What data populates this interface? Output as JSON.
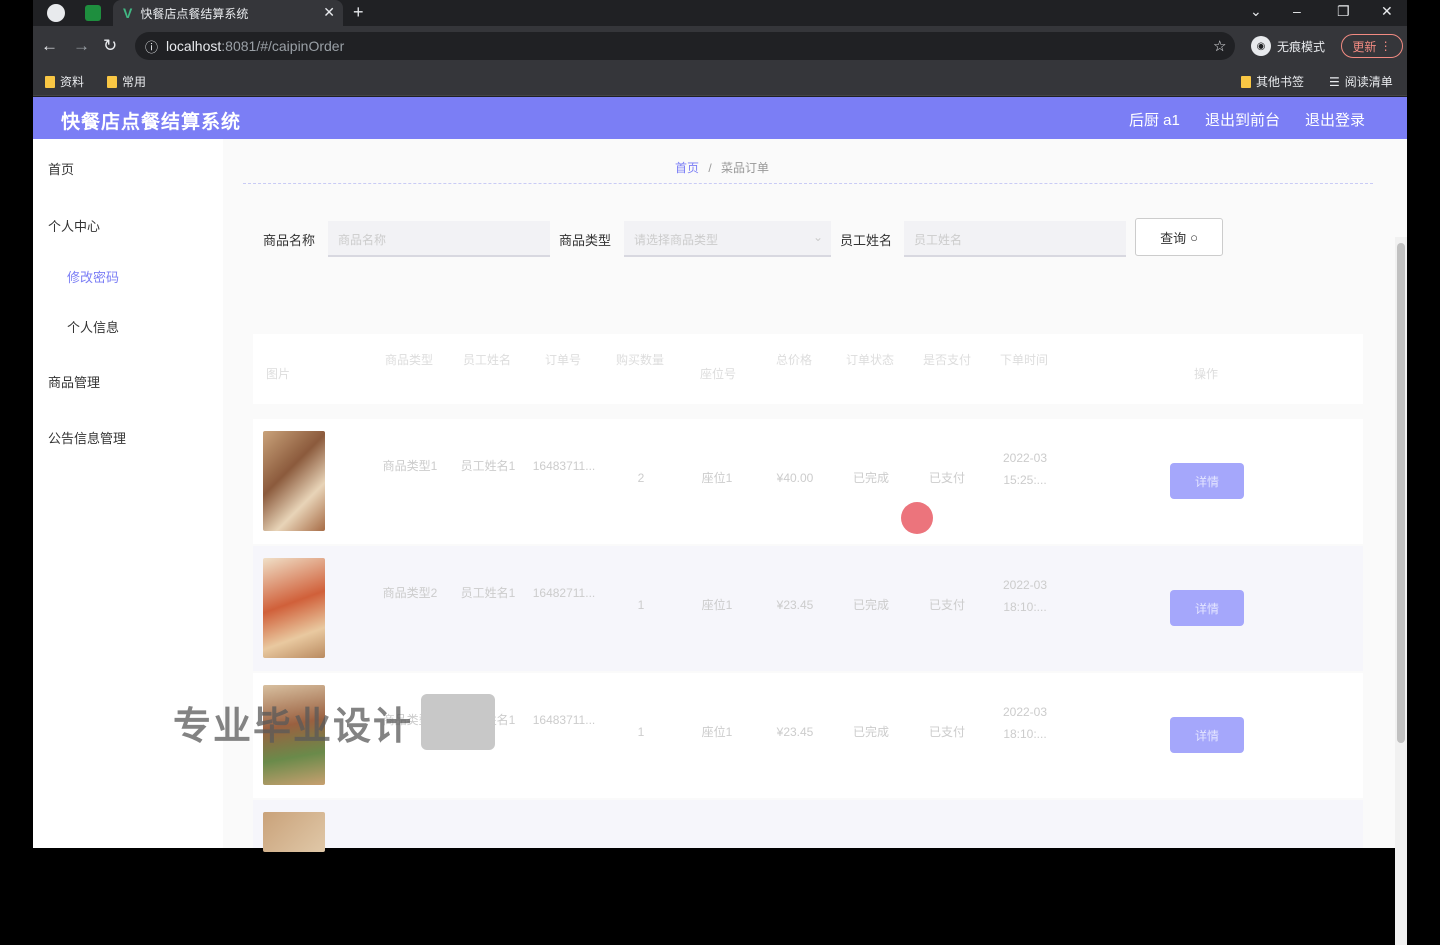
{
  "browser": {
    "tab_title": "快餐店点餐结算系统",
    "url_host": "localhost",
    "url_path": ":8081/#/caipinOrder",
    "incognito_label": "无痕模式",
    "update_label": "更新",
    "bookmarks": [
      "资料",
      "常用"
    ],
    "bookmarks_right": [
      "其他书签",
      "阅读清单"
    ]
  },
  "app": {
    "title": "快餐店点餐结算系统",
    "user_label": "后厨 a1",
    "front_label": "退出到前台",
    "logout_label": "退出登录"
  },
  "sidebar": {
    "items": [
      "首页",
      "个人中心",
      "修改密码",
      "个人信息",
      "商品管理",
      "公告信息管理"
    ]
  },
  "breadcrumb": {
    "home": "首页",
    "sep": "/",
    "current": "菜品订单"
  },
  "search": {
    "name_label": "商品名称",
    "name_placeholder": "商品名称",
    "type_label": "商品类型",
    "type_placeholder": "请选择商品类型",
    "staff_label": "员工姓名",
    "staff_placeholder": "员工姓名",
    "button_label": "查询"
  },
  "table": {
    "headers": [
      "图片",
      "商品类型",
      "员工姓名",
      "订单号",
      "购买数量",
      "座位号",
      "总价格",
      "订单状态",
      "是否支付",
      "下单时间",
      "操作"
    ],
    "rows": [
      {
        "type": "商品类型1",
        "staff": "员工姓名1",
        "order": "16483711...",
        "qty": "2",
        "seat": "座位1",
        "price": "¥40.00",
        "status": "已完成",
        "paid": "已支付",
        "time": "2022-03 15:25:...",
        "op": "详情"
      },
      {
        "type": "商品类型2",
        "staff": "员工姓名1",
        "order": "16482711...",
        "qty": "1",
        "seat": "座位1",
        "price": "¥23.45",
        "status": "已完成",
        "paid": "已支付",
        "time": "2022-03 18:10:...",
        "op": "详情"
      },
      {
        "type": "商品类型1",
        "staff": "员工姓名1",
        "order": "16483711...",
        "qty": "1",
        "seat": "座位1",
        "price": "¥23.45",
        "status": "已完成",
        "paid": "已支付",
        "time": "2022-03 18:10:...",
        "op": "详情"
      }
    ]
  },
  "overlay": {
    "watermark": "专业毕业设计"
  },
  "colors": {
    "accent": "#7b7ef5",
    "button": "#a5a7fb"
  }
}
